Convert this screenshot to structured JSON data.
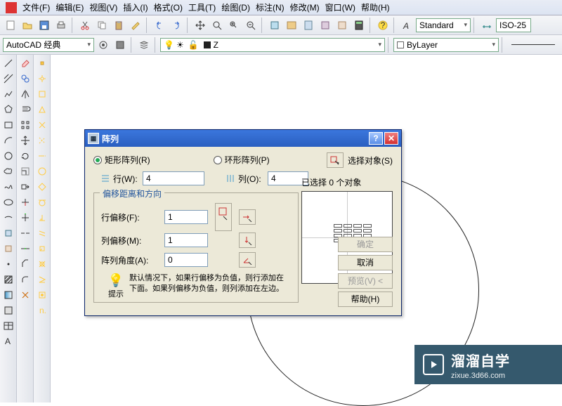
{
  "menu": {
    "file": "文件(F)",
    "edit": "编辑(E)",
    "view": "视图(V)",
    "insert": "插入(I)",
    "format": "格式(O)",
    "tools": "工具(T)",
    "draw": "绘图(D)",
    "dimension": "标注(N)",
    "modify": "修改(M)",
    "window": "窗口(W)",
    "help": "帮助(H)"
  },
  "toolbar2": {
    "workspace": "AutoCAD 经典",
    "layer": "Z",
    "linetype": "ByLayer",
    "textstyle": "Standard",
    "dimstyle": "ISO-25"
  },
  "dialog": {
    "title": "阵列",
    "rect_array": "矩形阵列(R)",
    "polar_array": "环形阵列(P)",
    "select_objects": "选择对象(S)",
    "selected_count": "已选择 0 个对象",
    "rows_label": "行(W):",
    "rows_value": "4",
    "cols_label": "列(O):",
    "cols_value": "4",
    "group_title": "偏移距离和方向",
    "row_offset_label": "行偏移(F):",
    "row_offset_value": "1",
    "col_offset_label": "列偏移(M):",
    "col_offset_value": "1",
    "angle_label": "阵列角度(A):",
    "angle_value": "0",
    "tip_label": "提示",
    "tip_text": "默认情况下，如果行偏移为负值，则行添加在下面。如果列偏移为负值，则列添加在左边。",
    "ok": "确定",
    "cancel": "取消",
    "preview_btn": "预览(V) <",
    "help": "帮助(H)"
  },
  "watermark": {
    "main": "溜溜自学",
    "sub": "zixue.3d66.com"
  }
}
